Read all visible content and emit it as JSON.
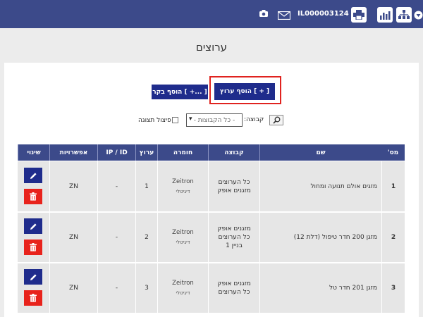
{
  "topbar": {
    "account_id": "IL000003124",
    "icons": [
      "camera-icon",
      "mail-icon",
      "printer-icon",
      "bar-chart-icon",
      "sitemap-icon",
      "dropdown-icon"
    ]
  },
  "page": {
    "title": "ערוצים"
  },
  "toolbar": {
    "add_channel_label": "[ + ] הוסף ערוץ",
    "add_controller_label": "[ ...+ ] הוסף בקר"
  },
  "filter": {
    "group_label": "קבוצה:",
    "group_value": "- כל הקבוצות -",
    "split_label": "פיצול תצוגה"
  },
  "table": {
    "headers": [
      "מס'",
      "שם",
      "קבוצה",
      "חומרה",
      "ערוץ",
      "IP / ID",
      "אפשרויות",
      "שינוי"
    ],
    "rows": [
      {
        "num": "1",
        "name": "מזגים אולם תנועה ומחול",
        "group_lines": [
          "כל הערוצים",
          "מזגנים אופק"
        ],
        "hw_name": "Zeitron",
        "hw_sub": "דיגיטלי",
        "channel": "1",
        "ip": "-",
        "options": "ZN"
      },
      {
        "num": "2",
        "name": "מזגן 200 חדר טיפול (דלת 12)",
        "group_lines": [
          "מזגנים אופק",
          "כל הערוצים",
          "בניין 1"
        ],
        "hw_name": "Zeitron",
        "hw_sub": "דיגיטלי",
        "channel": "2",
        "ip": "-",
        "options": "ZN"
      },
      {
        "num": "3",
        "name": "מזגן 201 חדר טל",
        "group_lines": [
          "מזגנים אופק",
          "כל הערוצים"
        ],
        "hw_name": "Zeitron",
        "hw_sub": "דיגיטלי",
        "channel": "3",
        "ip": "-",
        "options": "ZN"
      }
    ]
  },
  "colors": {
    "header_bg": "#3c4a8a",
    "button_blue": "#1f2c8c",
    "delete_red": "#e8231c",
    "highlight_red": "#e0231f"
  }
}
